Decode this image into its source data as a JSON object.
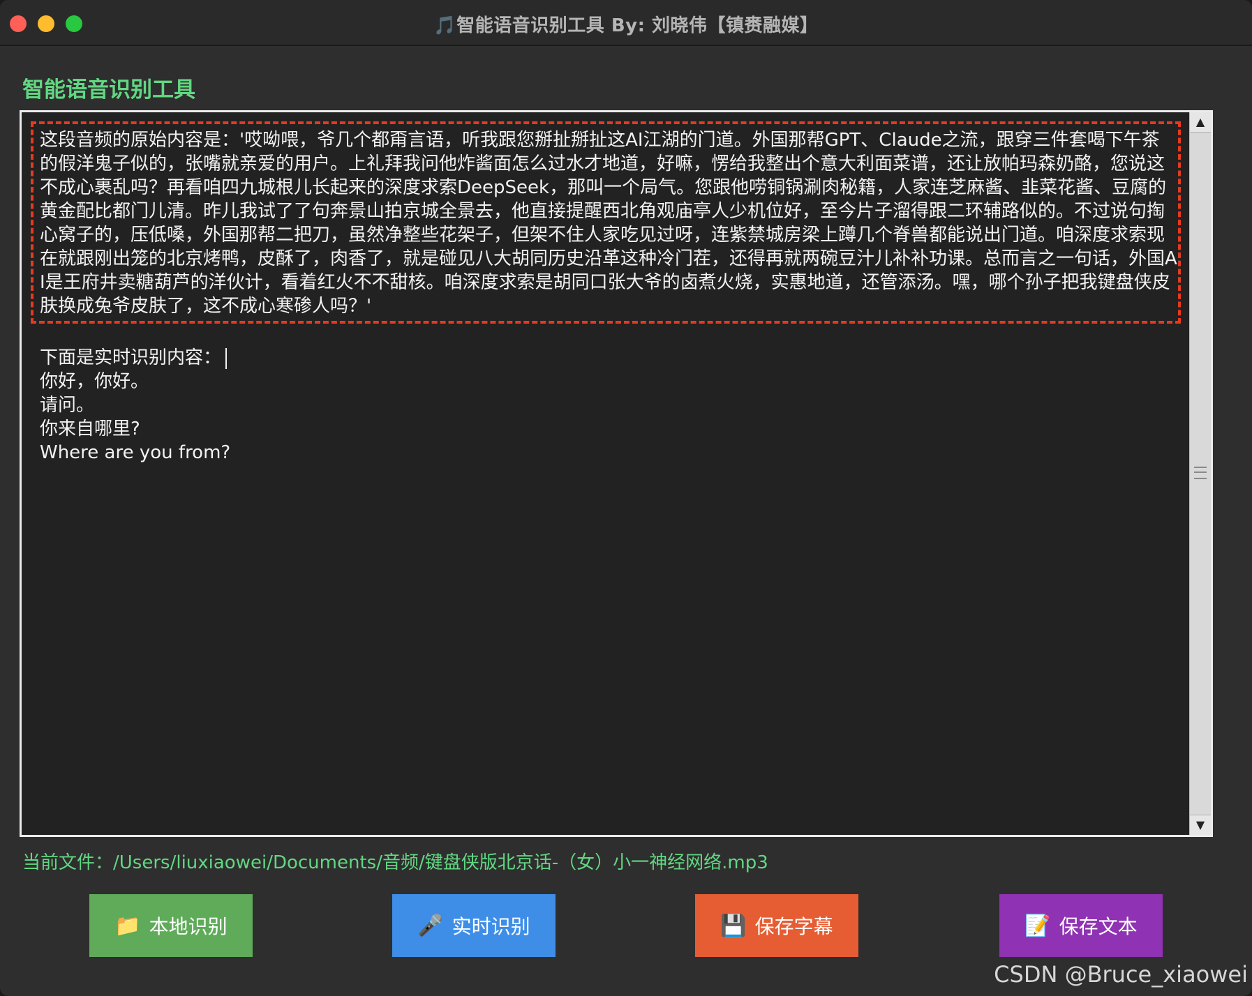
{
  "window": {
    "title": "🎵智能语音识别工具 By: 刘晓伟【镇赉融媒】"
  },
  "app": {
    "title": "智能语音识别工具"
  },
  "text_area": {
    "original_text": "这段音频的原始内容是：'哎呦喂，爷几个都甭言语，听我跟您掰扯掰扯这AI江湖的门道。外国那帮GPT、Claude之流，跟穿三件套喝下午茶的假洋鬼子似的，张嘴就亲爱的用户。上礼拜我问他炸酱面怎么过水才地道，好嘛，愣给我整出个意大利面菜谱，还让放帕玛森奶酪，您说这不成心裹乱吗？再看咱四九城根儿长起来的深度求索DeepSeek，那叫一个局气。您跟他唠铜锅涮肉秘籍，人家连芝麻酱、韭菜花酱、豆腐的黄金配比都门儿清。昨儿我试了了句奔景山拍京城全景去，他直接提醒西北角观庙亭人少机位好，至今片子溜得跟二环辅路似的。不过说句掏心窝子的，压低嗓，外国那帮二把刀，虽然净整些花架子，但架不住人家吃见过呀，连紫禁城房梁上蹲几个脊兽都能说出门道。咱深度求索现在就跟刚出笼的北京烤鸭，皮酥了，肉香了，就是碰见八大胡同历史沿革这种冷门茬，还得再就两碗豆汁儿补补功课。总而言之一句话，外国AI是王府井卖糖葫芦的洋伙计，看着红火不不甜核。咱深度求索是胡同口张大爷的卤煮火烧，实惠地道，还管添汤。嘿，哪个孙子把我键盘侠皮肤换成兔爷皮肤了，这不成心寒碜人吗？'",
    "realtime_header": "下面是实时识别内容：",
    "realtime_lines": [
      "你好，你好。",
      "请问。",
      "你来自哪里?",
      "Where are you from?"
    ]
  },
  "status": {
    "current_file_label": "当前文件：",
    "current_file_path": "/Users/liuxiaowei/Documents/音频/键盘侠版北京话-（女）小一神经网络.mp3"
  },
  "buttons": {
    "local": {
      "icon": "📁",
      "label": "本地识别"
    },
    "realtime": {
      "icon": "🎤",
      "label": "实时识别"
    },
    "save_subtitles": {
      "icon": "💾",
      "label": "保存字幕"
    },
    "save_text": {
      "icon": "📝",
      "label": "保存文本"
    }
  },
  "scrollbar": {
    "up": "▲",
    "down": "▼"
  },
  "watermark": "CSDN @Bruce_xiaowei",
  "colors": {
    "accent_green": "#62d782",
    "highlight_red": "#e53a1f",
    "btn_local": "#5fab5a",
    "btn_realtime": "#3e8ee8",
    "btn_subs": "#e65d33",
    "btn_text": "#8f32b3"
  }
}
